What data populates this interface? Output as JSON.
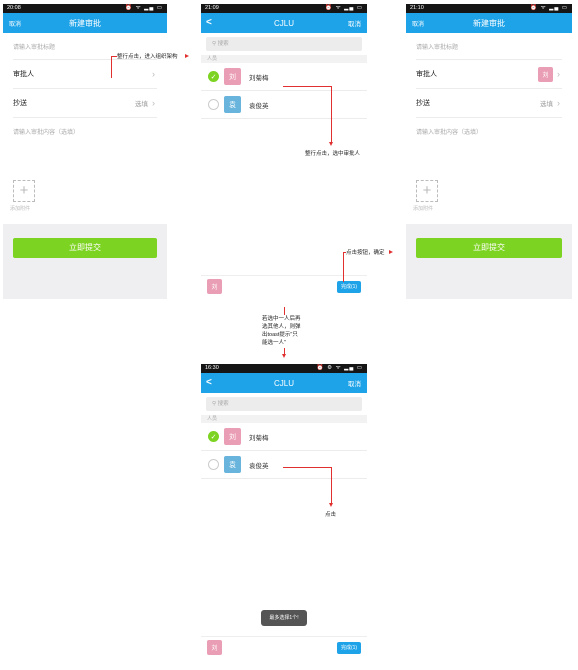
{
  "screen1": {
    "status_time": "20:08",
    "status_icons": "⏰ ᯤ ▂▄ ▭",
    "nav_left": "取消",
    "nav_title": "新建审批",
    "title_placeholder": "请输入审批标题",
    "approver_label": "审批人",
    "cc_label": "抄送",
    "cc_value": "选填",
    "content_placeholder": "请输入审批内容（选填）",
    "attach_label": "添加附件",
    "submit_label": "立即提交"
  },
  "screen2": {
    "status_time": "21:09",
    "status_icons": "⏰ ᯤ ▂▄ ▭",
    "nav_back": "<",
    "nav_title": "CJLU",
    "nav_right": "取消",
    "search_placeholder": "搜索",
    "section_label": "人员",
    "people": [
      {
        "avatar": "刘",
        "name": "刘菊梅",
        "checked": true
      },
      {
        "avatar": "袁",
        "name": "袁俊英",
        "checked": false
      }
    ],
    "bottom_avatar": "刘",
    "done_label": "完成(1)"
  },
  "screen3": {
    "status_time": "21:10",
    "status_icons": "⏰ ᯤ ▂▄ ▭",
    "nav_left": "取消",
    "nav_title": "新建审批",
    "title_placeholder": "请输入审批标题",
    "approver_label": "审批人",
    "approver_avatar": "刘",
    "cc_label": "抄送",
    "cc_value": "选填",
    "content_placeholder": "请输入审批内容（选填）",
    "attach_label": "添加附件",
    "submit_label": "立即提交"
  },
  "screen4": {
    "status_time": "16:30",
    "status_icons": "⏰ ⚙ ᯤ ▂▄ ▭",
    "nav_back": "<",
    "nav_title": "CJLU",
    "nav_right": "取消",
    "search_placeholder": "搜索",
    "section_label": "人员",
    "people": [
      {
        "avatar": "刘",
        "name": "刘菊梅",
        "checked": true
      },
      {
        "avatar": "袁",
        "name": "袁俊英",
        "checked": false
      }
    ],
    "toast": "最多选择1个!",
    "bottom_avatar": "刘",
    "done_label": "完成(1)"
  },
  "annotations": {
    "a1": "整行点击，进入组织架构",
    "a2": "整行点击，选中审批人",
    "a3": "点击按钮，确定",
    "a4_line1": "若选中一人后再",
    "a4_line2": "选其他人，则弹",
    "a4_line3": "出toast提示\"只",
    "a4_line4": "能选一人\"",
    "a5": "点击"
  },
  "colors": {
    "nav_blue": "#1fa3e8",
    "submit_green": "#7dd321",
    "annotation_red": "#e03030",
    "avatar_pink": "#ea9eb5",
    "avatar_blue": "#68b4dc"
  }
}
